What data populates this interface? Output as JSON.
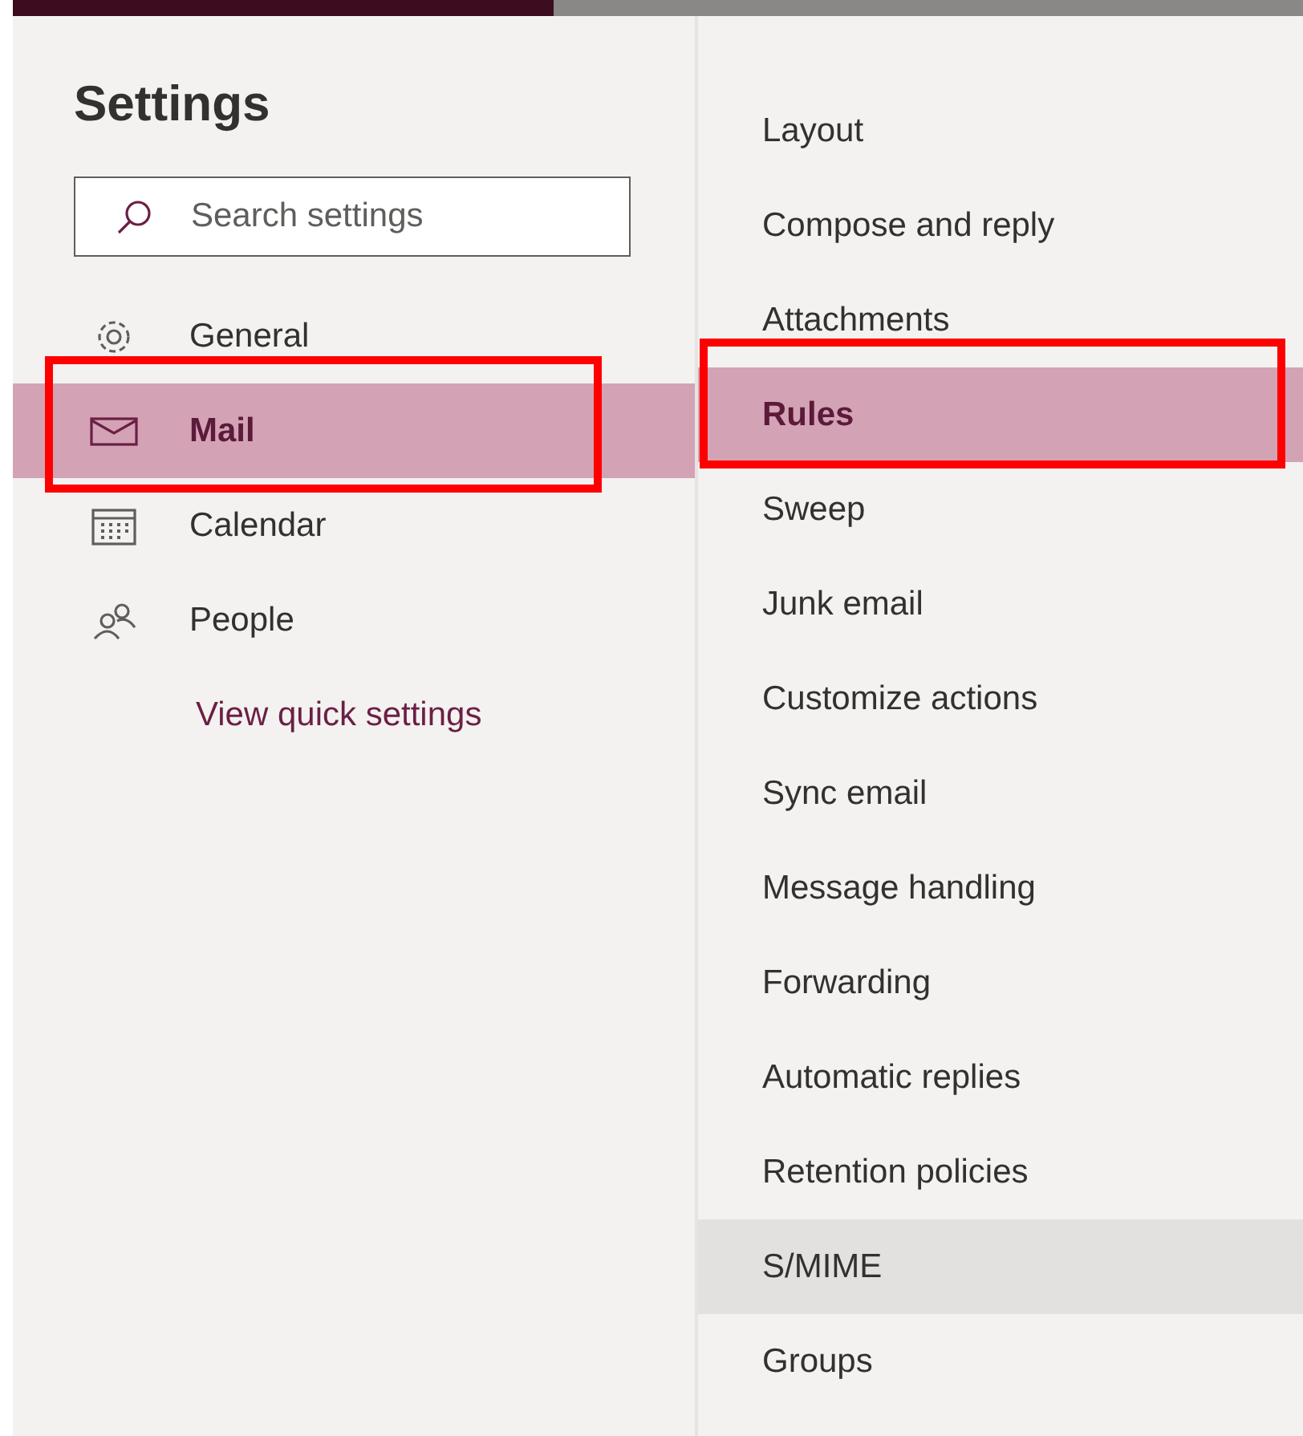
{
  "title": "Settings",
  "search": {
    "placeholder": "Search settings"
  },
  "categories": [
    {
      "kind": "gear",
      "label": "General",
      "selected": false,
      "highlighted": false
    },
    {
      "kind": "mail",
      "label": "Mail",
      "selected": true,
      "highlighted": true
    },
    {
      "kind": "calendar",
      "label": "Calendar",
      "selected": false,
      "highlighted": false
    },
    {
      "kind": "people",
      "label": "People",
      "selected": false,
      "highlighted": false
    }
  ],
  "quick_settings_link": "View quick settings",
  "sections": [
    {
      "label": "Layout",
      "selected": false,
      "hovered": false,
      "highlighted": false
    },
    {
      "label": "Compose and reply",
      "selected": false,
      "hovered": false,
      "highlighted": false
    },
    {
      "label": "Attachments",
      "selected": false,
      "hovered": false,
      "highlighted": false
    },
    {
      "label": "Rules",
      "selected": true,
      "hovered": false,
      "highlighted": true
    },
    {
      "label": "Sweep",
      "selected": false,
      "hovered": false,
      "highlighted": false
    },
    {
      "label": "Junk email",
      "selected": false,
      "hovered": false,
      "highlighted": false
    },
    {
      "label": "Customize actions",
      "selected": false,
      "hovered": false,
      "highlighted": false
    },
    {
      "label": "Sync email",
      "selected": false,
      "hovered": false,
      "highlighted": false
    },
    {
      "label": "Message handling",
      "selected": false,
      "hovered": false,
      "highlighted": false
    },
    {
      "label": "Forwarding",
      "selected": false,
      "hovered": false,
      "highlighted": false
    },
    {
      "label": "Automatic replies",
      "selected": false,
      "hovered": false,
      "highlighted": false
    },
    {
      "label": "Retention policies",
      "selected": false,
      "hovered": false,
      "highlighted": false
    },
    {
      "label": "S/MIME",
      "selected": false,
      "hovered": true,
      "highlighted": false
    },
    {
      "label": "Groups",
      "selected": false,
      "hovered": false,
      "highlighted": false
    }
  ]
}
